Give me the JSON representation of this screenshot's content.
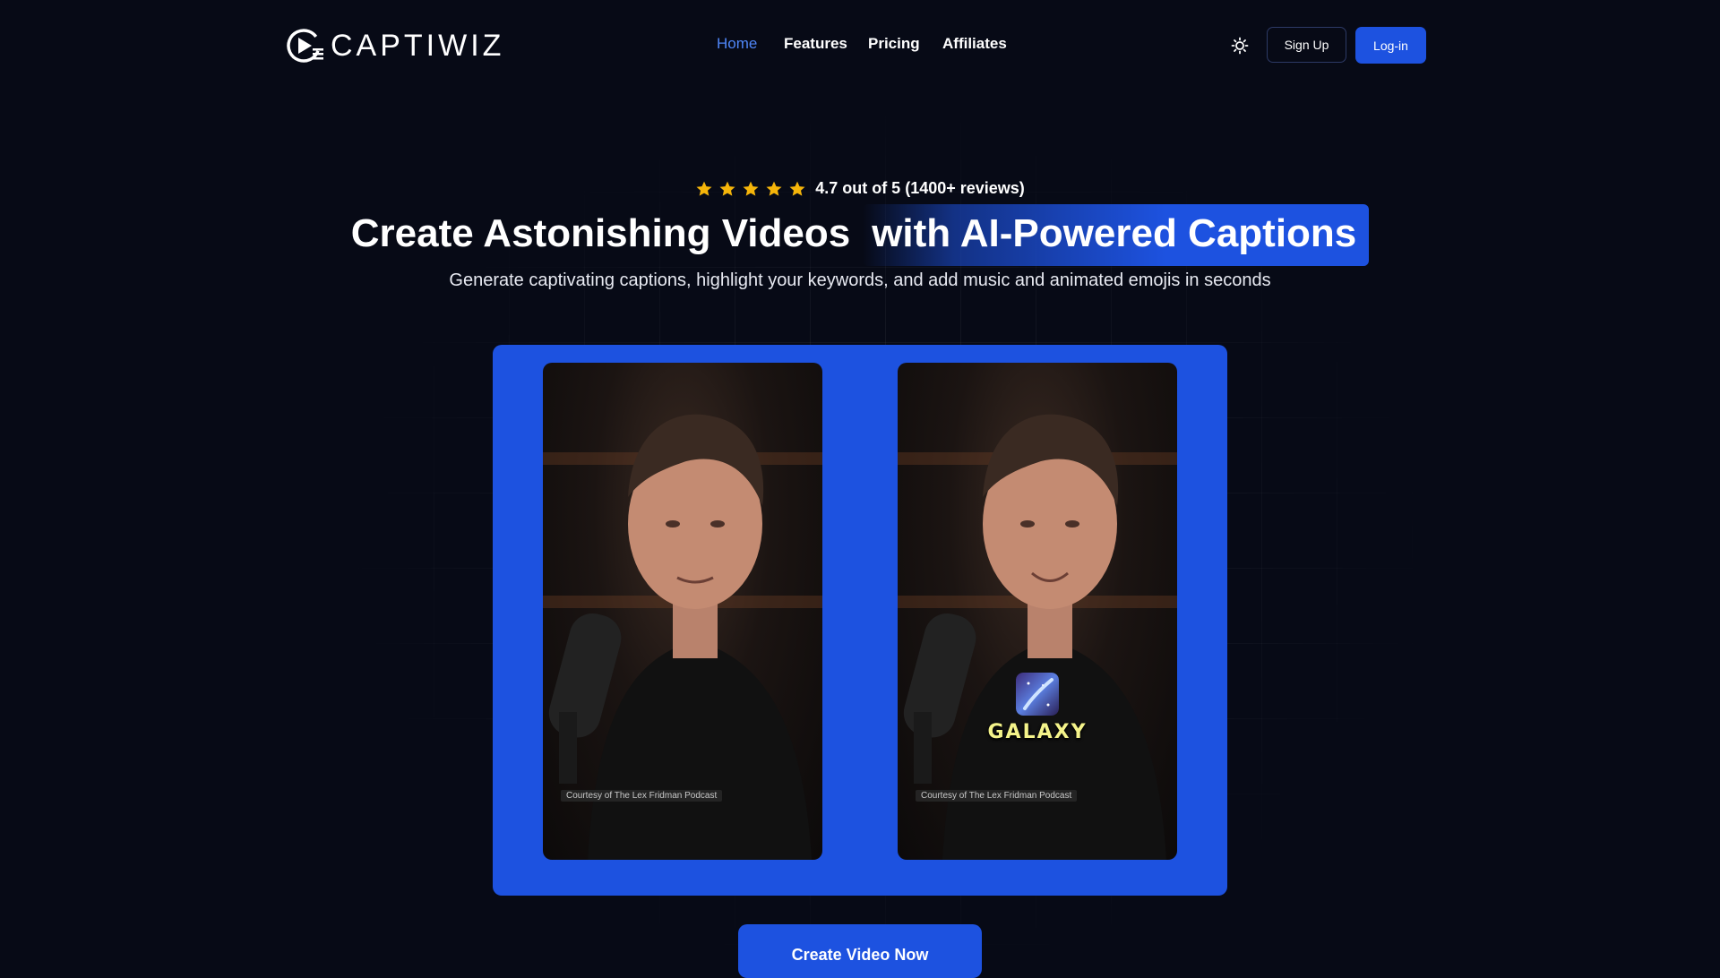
{
  "brand": {
    "name": "CAPTIWIZ"
  },
  "nav": {
    "items": [
      {
        "label": "Home",
        "active": true
      },
      {
        "label": "Features",
        "active": false
      },
      {
        "label": "Pricing",
        "active": false
      },
      {
        "label": "Affiliates",
        "active": false
      }
    ]
  },
  "header": {
    "theme_icon": "sun-icon",
    "signup_label": "Sign Up",
    "login_label": "Log-in"
  },
  "hero": {
    "rating_stars": 5,
    "rating_text": "4.7 out of 5 (1400+ reviews)",
    "headline_part1": "Create Astonishing Videos",
    "headline_part2": "with AI-Powered Captions",
    "subtitle": "Generate captivating captions, highlight your keywords, and add music and animated emojis in seconds"
  },
  "demo": {
    "left_credit": "Courtesy of The Lex Fridman Podcast",
    "right_credit": "Courtesy of The Lex Fridman Podcast",
    "caption_word": "GALAXY",
    "caption_emoji": "galaxy-emoji-icon"
  },
  "cta": {
    "label": "Create Video Now"
  },
  "colors": {
    "accent": "#1d52e0",
    "nav_active": "#4f86f7",
    "background": "#070a16",
    "caption": "#f4f38a",
    "star": "#f5b50a"
  }
}
